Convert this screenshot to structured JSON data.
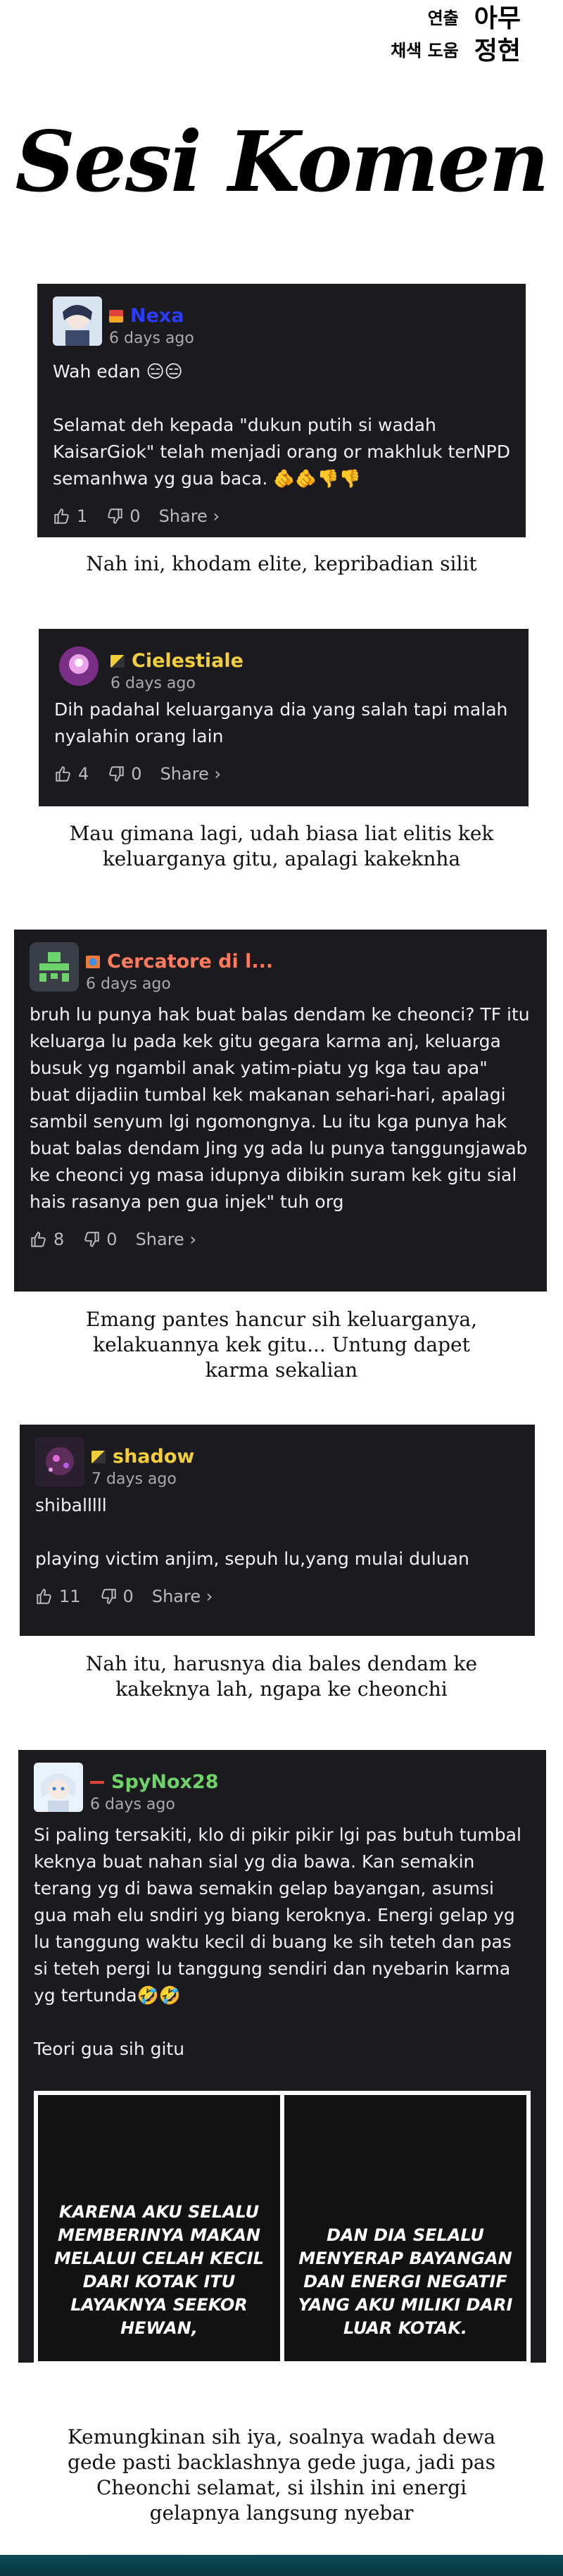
{
  "credits": [
    {
      "role": "연출",
      "name": "아무"
    },
    {
      "role": "채색 도움",
      "name": "정현"
    }
  ],
  "title": "Sesi Komen",
  "comments": [
    {
      "username": "Nexa",
      "username_color": "#2b3cff",
      "time": "6 days ago",
      "lines": [
        "Wah edan 😑😑"
      ],
      "lines2": [
        "Selamat deh kepada \"dukun putih si wadah KaisarGiok\" telah menjadi orang or makhluk terNPD semanhwa yg gua baca. 🫵🫵👎👎"
      ],
      "likes": "1",
      "dislikes": "0",
      "share": "Share ›",
      "caption": "Nah ini, khodam elite, kepribadian silit"
    },
    {
      "username": "Cielestiale",
      "username_color": "#f2cf3a",
      "time": "6 days ago",
      "lines": [
        "Dih padahal keluarganya dia yang salah tapi malah nyalahin orang lain"
      ],
      "likes": "4",
      "dislikes": "0",
      "share": "Share ›",
      "caption": "Mau gimana lagi, udah biasa liat elitis kek keluarganya gitu, apalagi kakeknha"
    },
    {
      "username": "Cercatore di l...",
      "username_color": "#ff7a5c",
      "time": "6 days ago",
      "lines": [
        "bruh lu punya hak buat balas dendam ke cheonci? TF itu keluarga lu pada kek gitu gegara karma anj, keluarga busuk yg ngambil anak yatim-piatu yg kga tau apa\" buat dijadiin tumbal kek makanan sehari-hari, apalagi sambil senyum lgi ngomongnya. Lu itu kga punya hak buat balas dendam Jing yg ada lu punya tanggungjawab ke cheonci yg masa idupnya dibikin suram kek gitu sial hais rasanya pen gua injek\" tuh org"
      ],
      "likes": "8",
      "dislikes": "0",
      "share": "Share ›",
      "caption": "Emang pantes hancur sih keluarganya, kelakuannya kek gitu... Untung dapet karma sekalian"
    },
    {
      "username": "shadow",
      "username_color": "#f2cf3a",
      "time": "7 days ago",
      "lines": [
        "shiballlll"
      ],
      "lines2": [
        "playing victim anjim, sepuh lu,yang mulai duluan"
      ],
      "likes": "11",
      "dislikes": "0",
      "share": "Share ›",
      "caption": "Nah itu, harusnya dia bales dendam ke kakeknya lah, ngapa ke cheonchi"
    },
    {
      "username": "SpyNox28",
      "username_color": "#6fd36a",
      "time": "6 days ago",
      "lines": [
        "Si paling tersakiti, klo di pikir pikir lgi pas butuh tumbal keknya buat nahan sial yg dia bawa. Kan semakin terang yg di bawa semakin gelap bayangan, asumsi gua mah elu sndiri yg biang keroknya. Energi gelap yg lu tanggung waktu kecil di buang ke sih teteh dan pas si teteh pergi lu tanggung sendiri dan nyebarin karma yg tertunda🤣🤣"
      ],
      "lines2": [
        "Teori gua sih gitu"
      ],
      "panel_left": "KARENA AKU SELALU MEMBERINYA MAKAN MELALUI CELAH KECIL DARI KOTAK ITU LAYAKNYA SEEKOR HEWAN,",
      "panel_right": "DAN DIA SELALU MENYERAP BAYANGAN DAN ENERGI NEGATIF YANG AKU MILIKI DARI LUAR KOTAK.",
      "caption": "Kemungkinan sih iya, soalnya wadah dewa gede pasti backlashnya gede juga, jadi pas Cheonchi selamat, si ilshin ini energi gelapnya langsung nyebar"
    }
  ]
}
